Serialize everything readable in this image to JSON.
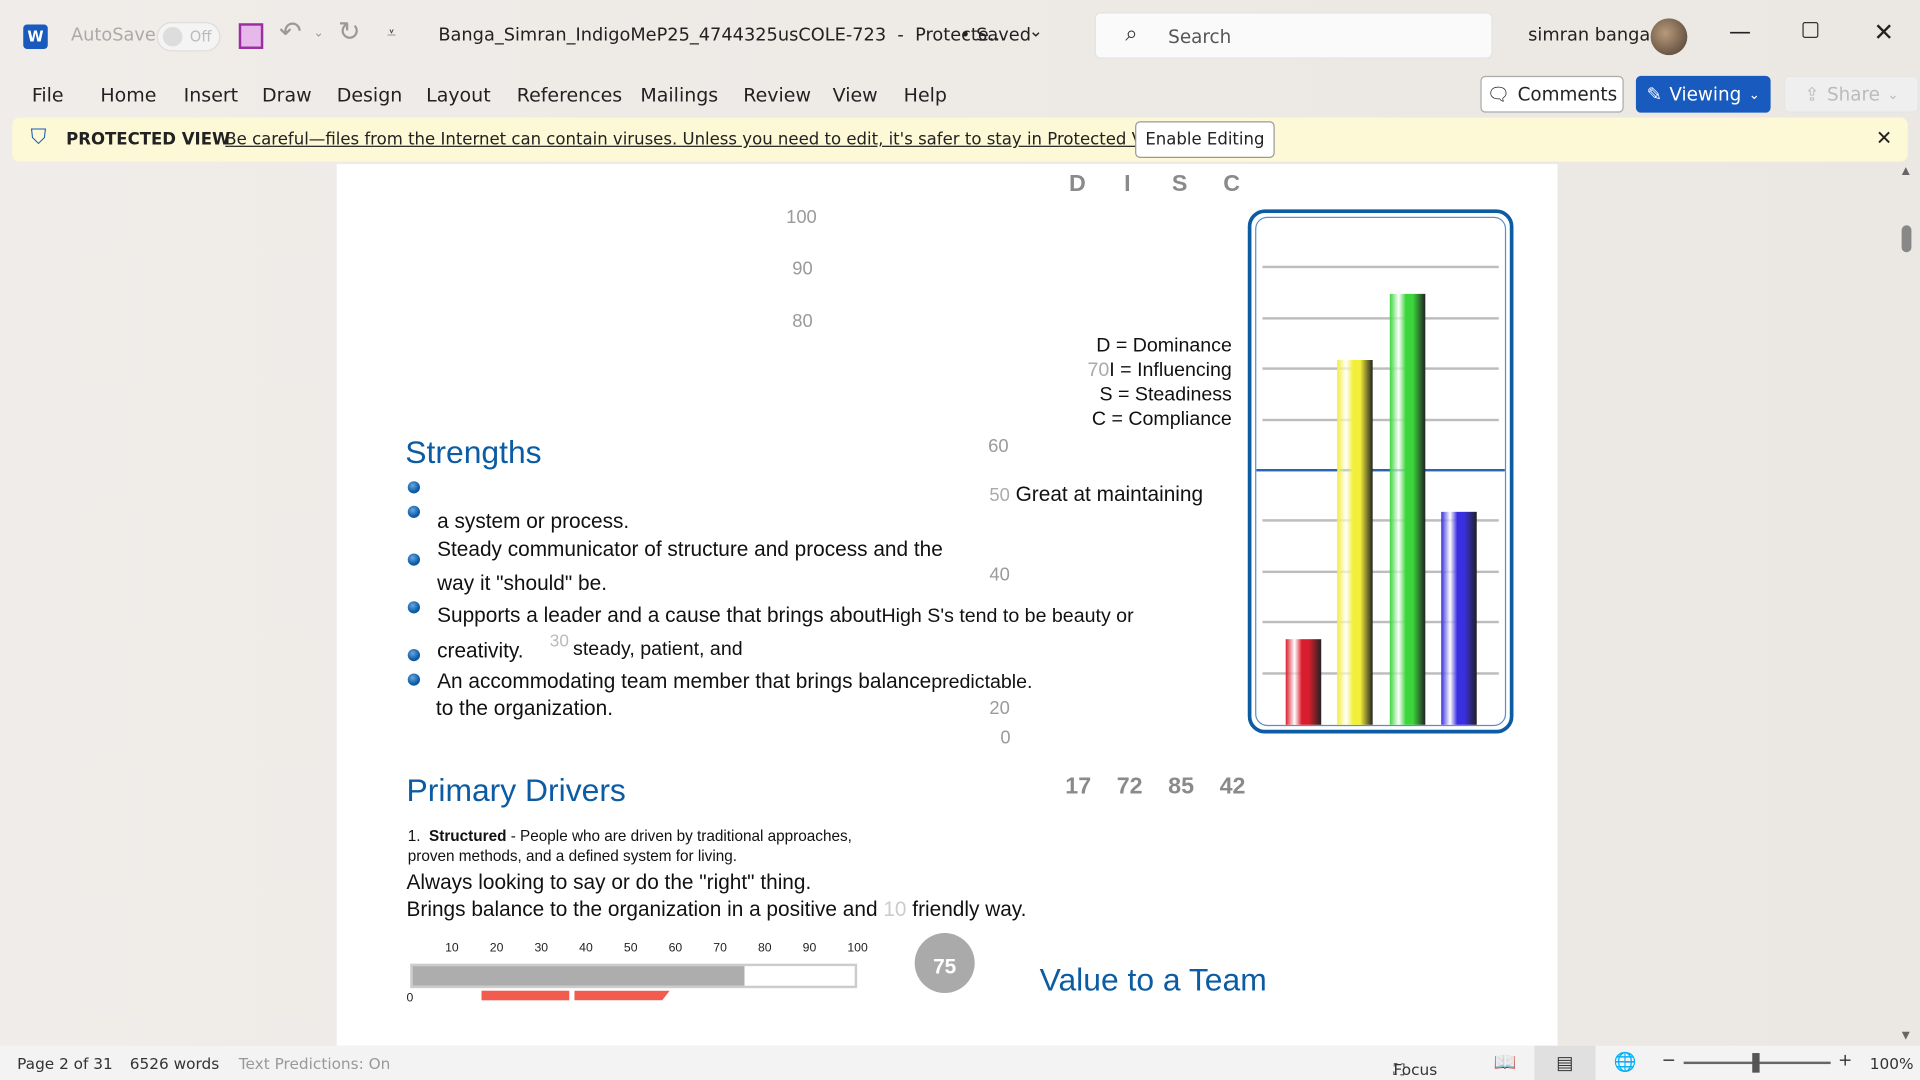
{
  "titlebar": {
    "autosave": "AutoSave",
    "toggle": "Off",
    "doc_title": "Banga_Simran_IndigoMeP25_4744325usCOLE-723  -  Protecte...",
    "saved": "• Saved",
    "search_placeholder": "Search",
    "user": "simran banga"
  },
  "menu": [
    "File",
    "Home",
    "Insert",
    "Draw",
    "Design",
    "Layout",
    "References",
    "Mailings",
    "Review",
    "View",
    "Help"
  ],
  "actions": {
    "comments": "Comments",
    "viewing": "Viewing",
    "share": "Share"
  },
  "protected": {
    "label": "PROTECTED VIEW",
    "message": "Be careful—files from the Internet can contain viruses. Unless you need to edit, it's safer to stay in Protected View.",
    "enable": "Enable Editing"
  },
  "doc": {
    "disc_letters": [
      "D",
      "I",
      "S",
      "C"
    ],
    "ticks_left": [
      "100",
      "90",
      "80"
    ],
    "legend": [
      "D = Dominance",
      "I = Influencing",
      "S = Steadiness",
      "C = Compliance"
    ],
    "stray": {
      "t70": "70",
      "t60": "60",
      "t50": "50",
      "t40": "40",
      "t30": "30",
      "t20": "20",
      "t0": "0",
      "t10": "10"
    },
    "strengths_title": "Strengths",
    "great": "Great at maintaining",
    "lines": [
      "a system or process.",
      "Steady communicator of structure and process and the",
      "way it \"should\" be.",
      "Supports a leader and a cause that brings about",
      "High S's tend to be beauty or",
      "creativity.",
      "steady, patient, and",
      "An accommodating team member that brings balance",
      "predictable.",
      "to the organization."
    ],
    "drivers_title": "Primary Drivers",
    "scores": [
      "17",
      "72",
      "85",
      "42"
    ],
    "driver_num": "1.",
    "driver_name": "Structured",
    "driver_desc1": " - People who are driven by traditional approaches,",
    "driver_desc2": "proven methods, and a defined system for living.",
    "p1": "Always looking to say or do the \"right\" thing.",
    "p2": "Brings balance to the organization in a positive and",
    "p2b": "friendly way.",
    "scale_ticks": [
      "10",
      "20",
      "30",
      "40",
      "50",
      "60",
      "70",
      "80",
      "90",
      "100"
    ],
    "scale_zero": "0",
    "score_value": 75,
    "score_label": "75",
    "value_title": "Value to a Team"
  },
  "chart_data": {
    "type": "bar",
    "categories": [
      "D",
      "I",
      "S",
      "C"
    ],
    "values": [
      17,
      72,
      85,
      42
    ],
    "ylim": [
      0,
      100
    ],
    "colors": [
      "#d81e2e",
      "#f2ee3a",
      "#3cd63c",
      "#3a2fe0"
    ],
    "grid": true
  },
  "status": {
    "page": "Page 2 of 31",
    "words": "6526 words",
    "predictions": "Text Predictions: On",
    "focus": "Focus",
    "zoom": "100%"
  }
}
